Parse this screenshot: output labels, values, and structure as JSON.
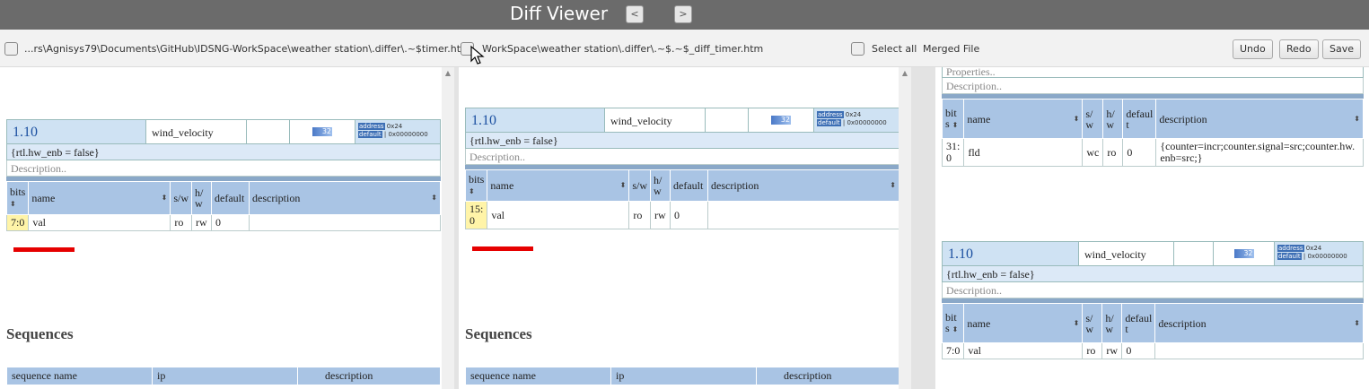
{
  "window": {
    "title": "Diff Viewer",
    "prev_label": "<",
    "next_label": ">"
  },
  "toolbar": {
    "left_path": "...rs\\Agnisys79\\Documents\\GitHub\\IDSNG-WorkSpace\\weather station\\.differ\\.~$timer.htm",
    "right_path": "WorkSpace\\weather station\\.differ\\.~$.~$_diff_timer.htm",
    "select_all": "Select all",
    "merged_file": "Merged File",
    "undo": "Undo",
    "redo": "Redo",
    "save": "Save"
  },
  "headers": {
    "bits": "bits",
    "bit_s": "bit s",
    "name": "name",
    "sw": "s/w",
    "hw": "h/ w",
    "s_w": "s/ w",
    "h_w": "h/ w",
    "default": "default",
    "defaul_t": "defaul t",
    "description": "description",
    "sort": "⬍"
  },
  "left": {
    "offset": "1.10",
    "reg_name": "wind_velocity",
    "width_icon": "32",
    "addr_label": "address",
    "addr_value": "0x24",
    "default_label": "default",
    "default_value": "0x00000000",
    "props": "{rtl.hw_enb = false}",
    "desc_placeholder": "Description..",
    "field": {
      "bits": "7:0",
      "name": "val",
      "sw": "ro",
      "hw": "rw",
      "default": "0",
      "description": ""
    },
    "seq_title": "Sequences",
    "seq_cols": [
      "sequence name",
      "ip",
      "description"
    ]
  },
  "middle": {
    "offset": "1.10",
    "reg_name": "wind_velocity",
    "width_icon": "32",
    "addr_label": "address",
    "addr_value": "0x24",
    "default_label": "default",
    "default_value": "0x00000000",
    "props": "{rtl.hw_enb = false}",
    "desc_placeholder": "Description..",
    "field": {
      "bits": "15: 0",
      "name": "val",
      "sw": "ro",
      "hw": "rw",
      "default": "0",
      "description": ""
    },
    "seq_title": "Sequences",
    "seq_cols": [
      "sequence name",
      "ip",
      "description"
    ]
  },
  "merged": {
    "top": {
      "props_partial": "Properties..",
      "desc_placeholder": "Description..",
      "field": {
        "bits": "31: 0",
        "name": "fld",
        "sw": "wc",
        "hw": "ro",
        "default": "0",
        "description": "{counter=incr;counter.signal=src;counter.hw.enb=src;}"
      }
    },
    "bottom": {
      "offset": "1.10",
      "reg_name": "wind_velocity",
      "width_icon": "32",
      "addr_label": "address",
      "addr_value": "0x24",
      "default_label": "default",
      "default_value": "0x00000000",
      "props": "{rtl.hw_enb = false}",
      "desc_placeholder": "Description..",
      "field": {
        "bits": "7:0",
        "name": "val",
        "sw": "ro",
        "hw": "rw",
        "default": "0",
        "description": ""
      }
    }
  },
  "colors": {
    "titlebar": "#6b6b6b",
    "header_blue": "#a9c4e4",
    "offset_blue": "#1a4fa0",
    "diff_marker": "#e60000",
    "bits_highlight": "#fff4a8"
  }
}
